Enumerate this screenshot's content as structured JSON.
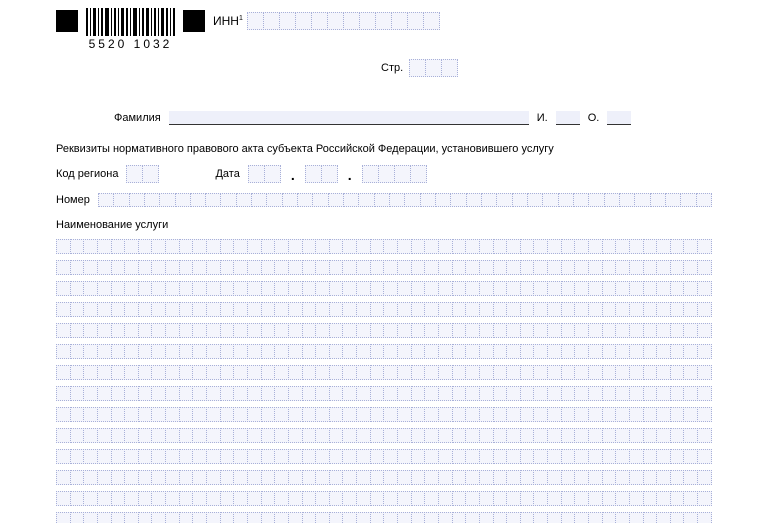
{
  "barcode_text": "5520 1032",
  "inn_label": "ИНН",
  "inn_sup": "1",
  "str_label": "Стр.",
  "surname_label": "Фамилия",
  "initial_i": "И.",
  "initial_o": "О.",
  "section_requisites": "Реквизиты нормативного правового акта субъекта Российской Федерации, установившего услугу",
  "region_code_label": "Код региона",
  "date_label": "Дата",
  "number_label": "Номер",
  "service_name_label": "Наименование услуги",
  "inn_cells": 12,
  "str_cells": 3,
  "region_cells": 2,
  "date_day_cells": 2,
  "date_month_cells": 2,
  "date_year_cells": 4,
  "number_cells": 40,
  "service_line_cells": 48,
  "service_lines": 14
}
